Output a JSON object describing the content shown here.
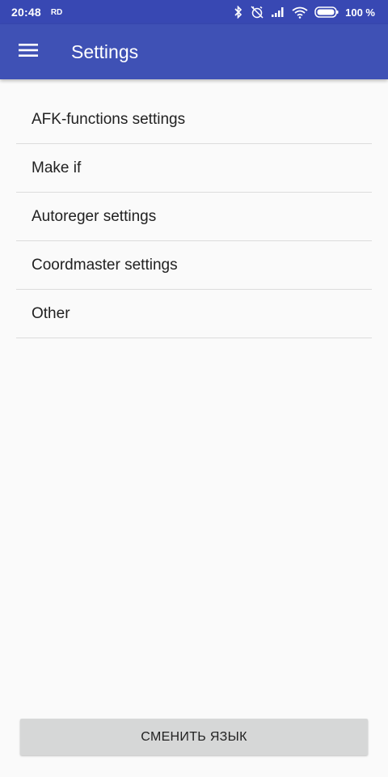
{
  "status_bar": {
    "time": "20:48",
    "carrier": "RD",
    "battery_percent": "100 %",
    "icons": [
      "bluetooth-icon",
      "alarm-off-icon",
      "signal-icon",
      "wifi-icon",
      "battery-icon"
    ]
  },
  "app_bar": {
    "title": "Settings",
    "menu_icon": "hamburger-menu-icon",
    "color": "#3f51b5"
  },
  "settings": {
    "items": [
      {
        "label": "AFK-functions settings"
      },
      {
        "label": "Make if"
      },
      {
        "label": "Autoreger settings"
      },
      {
        "label": "Coordmaster settings"
      },
      {
        "label": "Other"
      }
    ]
  },
  "footer": {
    "change_language_label": "СМЕНИТЬ ЯЗЫК"
  }
}
